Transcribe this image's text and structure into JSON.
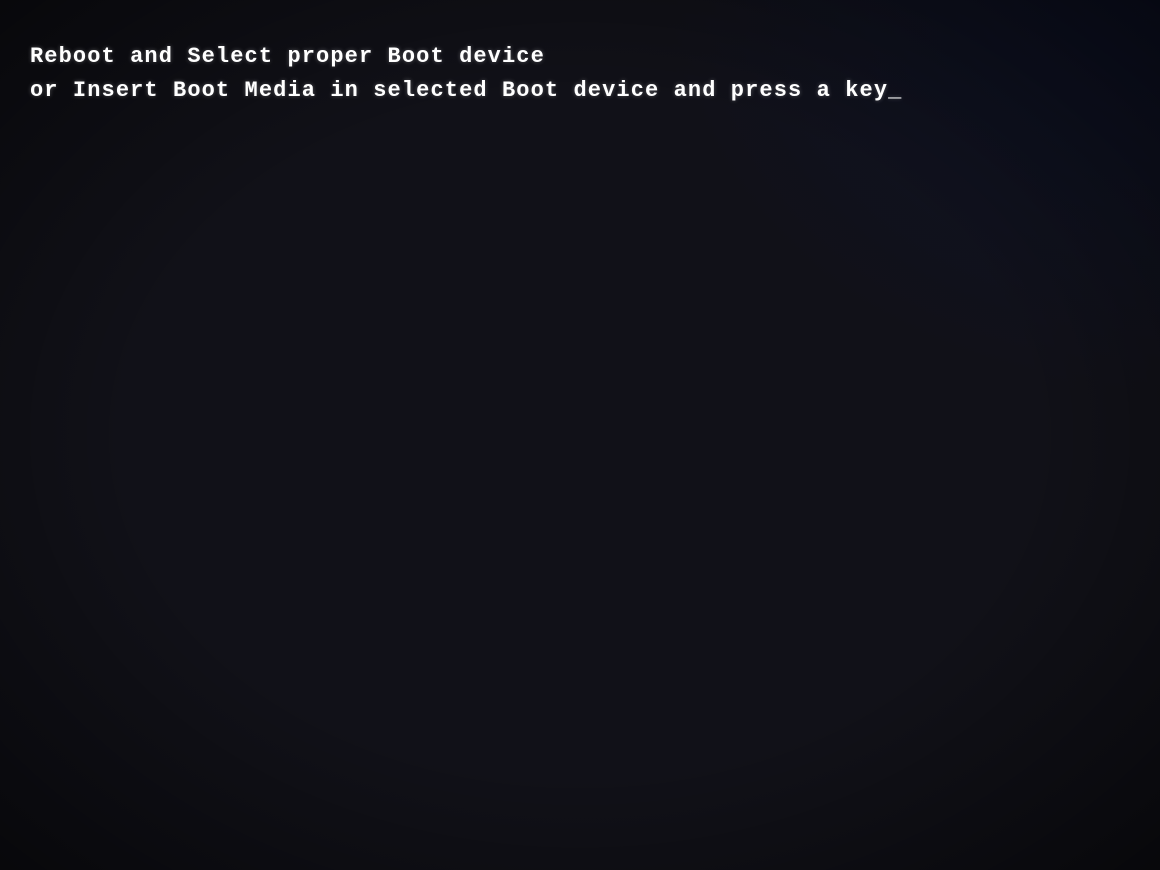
{
  "screen": {
    "background_color": "#0a0a10",
    "line1": "Reboot and Select proper Boot device",
    "line2": "or Insert Boot Media in selected Boot device and press a key_"
  }
}
